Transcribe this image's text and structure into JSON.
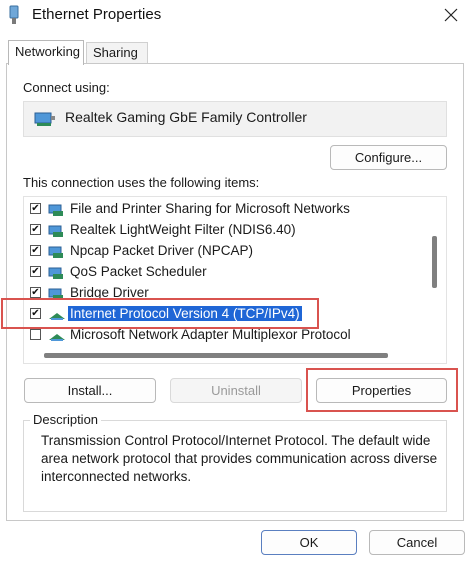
{
  "window": {
    "title": "Ethernet Properties"
  },
  "tabs": [
    {
      "label": "Networking"
    },
    {
      "label": "Sharing"
    }
  ],
  "connect_using": {
    "label": "Connect using:",
    "adapter": "Realtek Gaming GbE Family Controller"
  },
  "buttons": {
    "configure": "Configure...",
    "install": "Install...",
    "uninstall": "Uninstall",
    "properties": "Properties",
    "ok": "OK",
    "cancel": "Cancel"
  },
  "items_label": "This connection uses the following items:",
  "items": [
    {
      "label": "File and Printer Sharing for Microsoft Networks",
      "checked": true
    },
    {
      "label": "Realtek LightWeight Filter (NDIS6.40)",
      "checked": true
    },
    {
      "label": "Npcap Packet Driver (NPCAP)",
      "checked": true
    },
    {
      "label": "QoS Packet Scheduler",
      "checked": true
    },
    {
      "label": "Bridge Driver",
      "checked": true
    },
    {
      "label": "Internet Protocol Version 4 (TCP/IPv4)",
      "checked": true,
      "selected": true
    },
    {
      "label": "Microsoft Network Adapter Multiplexor Protocol",
      "checked": false
    }
  ],
  "description": {
    "title": "Description",
    "text": "Transmission Control Protocol/Internet Protocol. The default wide area network protocol that provides communication across diverse interconnected networks."
  },
  "colors": {
    "selection": "#1f66d6",
    "highlight": "#d9534f"
  }
}
